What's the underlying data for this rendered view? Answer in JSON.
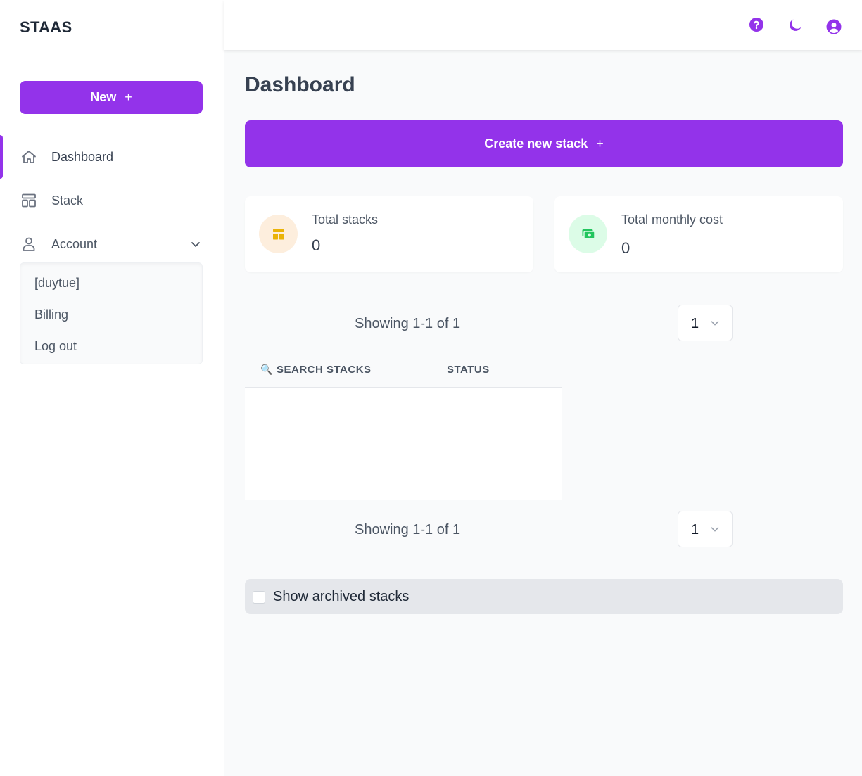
{
  "app": {
    "brand": "STAAS"
  },
  "sidebar": {
    "new_button": {
      "label": "New",
      "icon": "+"
    },
    "items": [
      {
        "label": "Dashboard",
        "icon": "home-icon",
        "active": true
      },
      {
        "label": "Stack",
        "icon": "layout-icon"
      },
      {
        "label": "Account",
        "icon": "user-icon",
        "expanded": true
      }
    ],
    "account_menu": [
      "[duytue]",
      "Billing",
      "Log out"
    ]
  },
  "topbar": {
    "icons": [
      "help-icon",
      "moon-icon",
      "user-circle-icon"
    ]
  },
  "main": {
    "title": "Dashboard",
    "create_button": {
      "label": "Create new stack",
      "icon": "+"
    },
    "cards": [
      {
        "label": "Total stacks",
        "value": "0",
        "icon": "stack-icon",
        "color": "#eab308",
        "bg": "#fef3e2"
      },
      {
        "label": "Total monthly cost",
        "value": "0",
        "icon": "cash-icon",
        "color": "#22c55e",
        "bg": "#dcfce7"
      }
    ],
    "pagination_top": {
      "showing": "Showing 1-1 of 1",
      "page": "1"
    },
    "table": {
      "columns": [
        "SEARCH STACKS",
        "STATUS"
      ],
      "search_icon": "🔍"
    },
    "pagination_bottom": {
      "showing": "Showing 1-1 of 1",
      "page": "1"
    },
    "archived_label": "Show archived stacks"
  },
  "colors": {
    "accent": "#9333ea"
  }
}
